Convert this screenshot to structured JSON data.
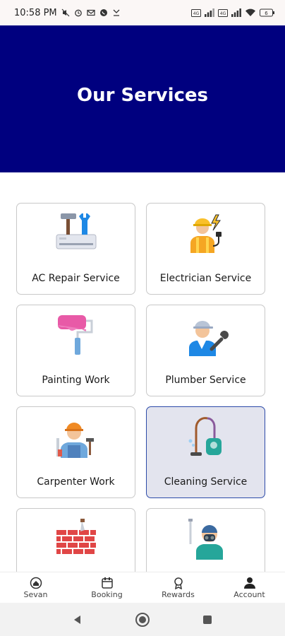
{
  "status_bar": {
    "time": "10:58 PM",
    "icons_left": [
      "mute-icon",
      "alarm-icon",
      "gmail-icon",
      "whatsapp-icon",
      "missed-call-icon"
    ],
    "icons_right": [
      "volte-icon",
      "signal-icon",
      "volte-icon",
      "signal-icon",
      "wifi-icon",
      "battery-icon"
    ]
  },
  "header": {
    "title": "Our Services",
    "bg_color": "#00007f"
  },
  "services": [
    {
      "label": "AC Repair Service",
      "icon": "ac-repair-icon"
    },
    {
      "label": "Electrician Service",
      "icon": "electrician-icon"
    },
    {
      "label": "Painting Work",
      "icon": "paint-roller-icon"
    },
    {
      "label": "Plumber Service",
      "icon": "plumber-icon"
    },
    {
      "label": "Carpenter Work",
      "icon": "carpenter-icon"
    },
    {
      "label": "Cleaning Service",
      "icon": "vacuum-cleaner-icon",
      "selected": true
    },
    {
      "label": "",
      "icon": "brick-wall-icon"
    },
    {
      "label": "",
      "icon": "pest-control-icon"
    }
  ],
  "bottom_nav": [
    {
      "label": "Sevan",
      "icon": "home-icon"
    },
    {
      "label": "Booking",
      "icon": "calendar-icon"
    },
    {
      "label": "Rewards",
      "icon": "medal-icon"
    },
    {
      "label": "Account",
      "icon": "person-icon"
    }
  ],
  "system_nav": [
    "back-icon",
    "home-circle-icon",
    "recents-icon"
  ]
}
